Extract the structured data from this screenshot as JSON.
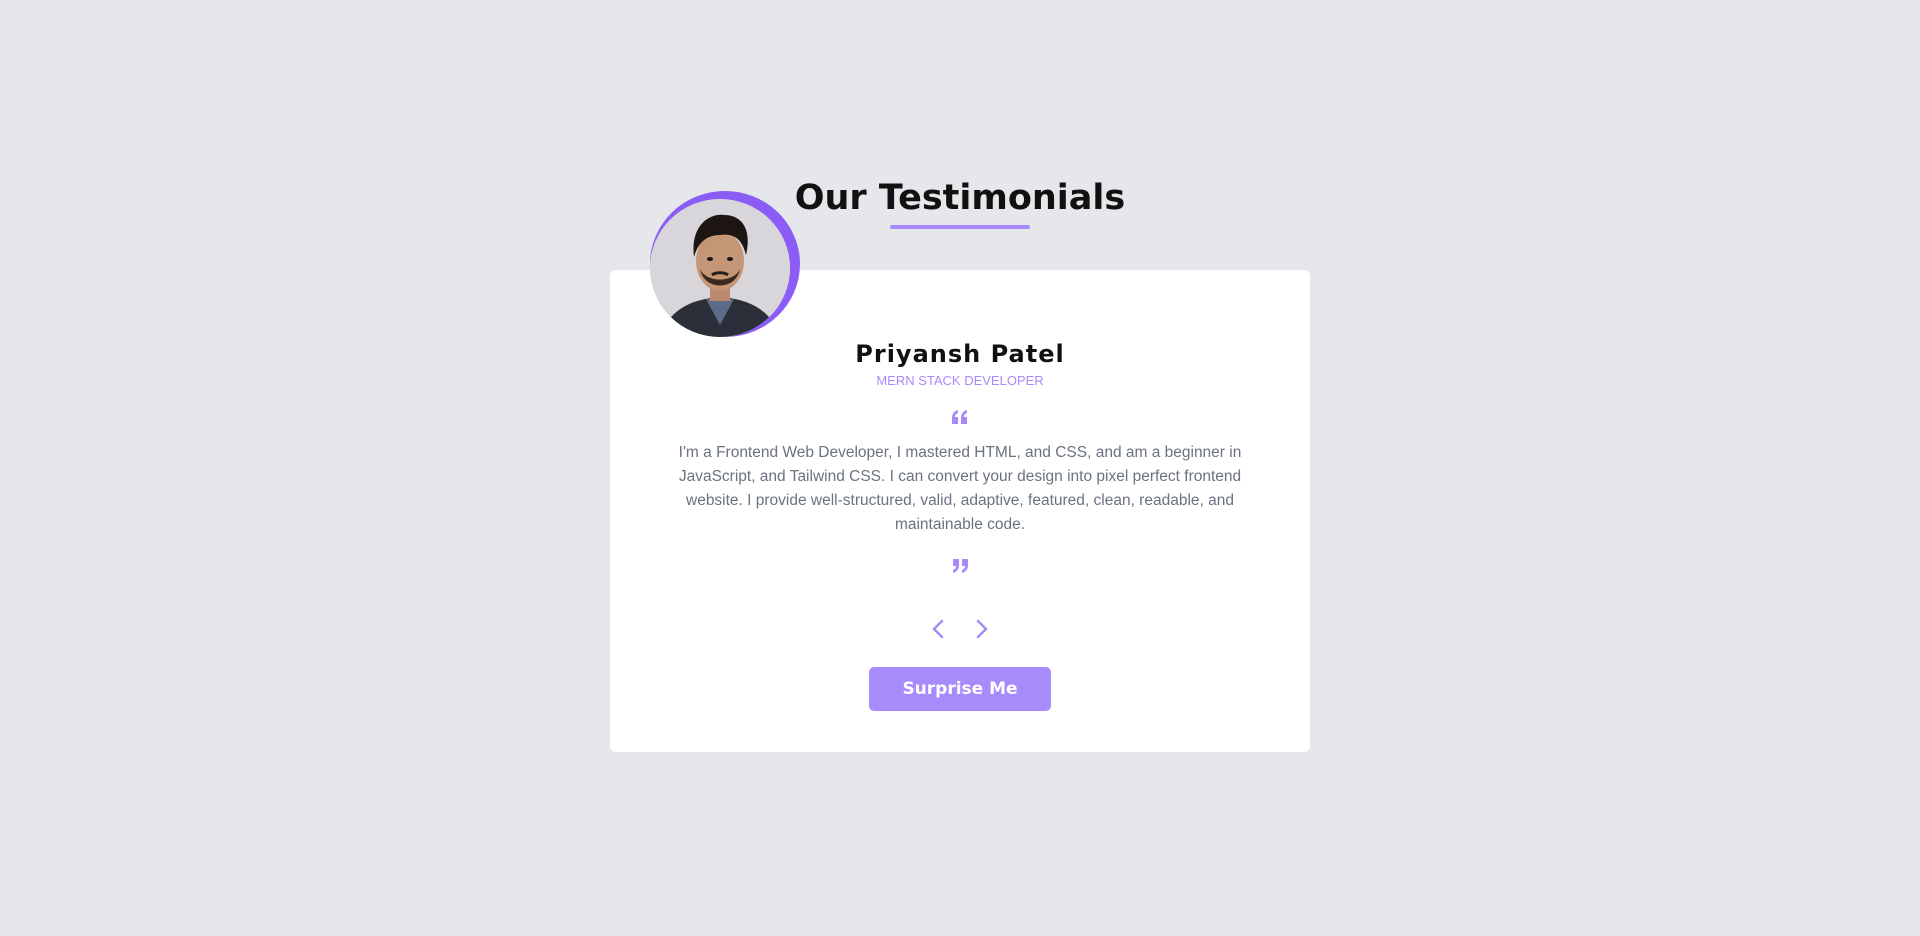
{
  "heading": "Our Testimonials",
  "testimonial": {
    "name": "Priyansh Patel",
    "role": "MERN STACK DEVELOPER",
    "text": "I'm a Frontend Web Developer, I mastered HTML, and CSS, and am a beginner in JavaScript, and Tailwind CSS. I can convert your design into pixel perfect frontend website. I provide well-structured, valid, adaptive, featured, clean, readable, and maintainable code."
  },
  "icons": {
    "open_quote": "quote-left-icon",
    "close_quote": "quote-right-icon",
    "prev": "chevron-left-icon",
    "next": "chevron-right-icon"
  },
  "button": {
    "label": "Surprise Me"
  },
  "colors": {
    "background": "#e5e7eb",
    "accent": "#a78bfa",
    "accent_dark": "#8b5cf6",
    "card": "#ffffff",
    "body_text": "#6b7280"
  }
}
